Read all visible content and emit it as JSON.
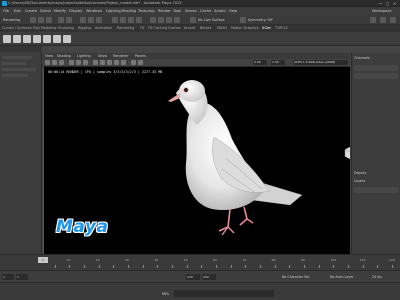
{
  "window": {
    "title": "C:/Users/AR/Documents/maya/projects/default/scenes/Pigeon_model.mb* - Autodesk Maya 2023",
    "controls": [
      "—",
      "□",
      "×"
    ]
  },
  "menubar": {
    "items": [
      "File",
      "Edit",
      "Create",
      "Select",
      "Modify",
      "Display",
      "Windows",
      "Lighting/Shading",
      "Texturing",
      "Render",
      "Toon",
      "Stereo",
      "Cache",
      "Arnold",
      "Help"
    ],
    "workspace_label": "Workspace"
  },
  "statusline": {
    "mode": "Rendering",
    "no_live_surface": "No Live Surface",
    "symmetry": "Symmetry: Off"
  },
  "shelf_tabs": [
    "Curves / Surfaces",
    "Poly Modeling",
    "Sculpting",
    "Rigging",
    "Animation",
    "Rendering",
    "FX",
    "FX Caching",
    "Custom",
    "Arnold",
    "Bifrost",
    "MASH",
    "Motion Graphics",
    "XGen",
    "TURTLE"
  ],
  "active_shelf_tab": "XGen",
  "viewport": {
    "menu": [
      "View",
      "Shading",
      "Lighting",
      "Show",
      "Renderer",
      "Panels"
    ],
    "toolbar": {
      "value_a": "0.00",
      "value_b": "1.00",
      "color_space": "ACES 1.0 SDR-video (sRGB)"
    },
    "hud_text": "00:00:14 RENDER  | CPU | samples 3/3/3/3/2/3  | 2277.33 MB",
    "logo_text": "Maya"
  },
  "right_panel": {
    "channel_label": "Channels",
    "display_label": "Display",
    "layers_label": "Layers"
  },
  "timeline": {
    "ticks": [
      5,
      10,
      15,
      20,
      25,
      30,
      35,
      40,
      45,
      50,
      55,
      60,
      65,
      70,
      75,
      80,
      85,
      90,
      95,
      100,
      105,
      110,
      115,
      120
    ],
    "current_frame": "1"
  },
  "range": {
    "start": "1",
    "end": "120",
    "anim_end": "200",
    "playback_end": "200",
    "character_set": "No Character Set",
    "anim_layer": "No Anim Layer",
    "fps": "24 fps"
  },
  "commandline": {
    "label": "MEL"
  },
  "colors": {
    "maya_blue": "#2196ee",
    "ui_dark": "#3c3c3c",
    "viewport_bg": "#000000"
  }
}
